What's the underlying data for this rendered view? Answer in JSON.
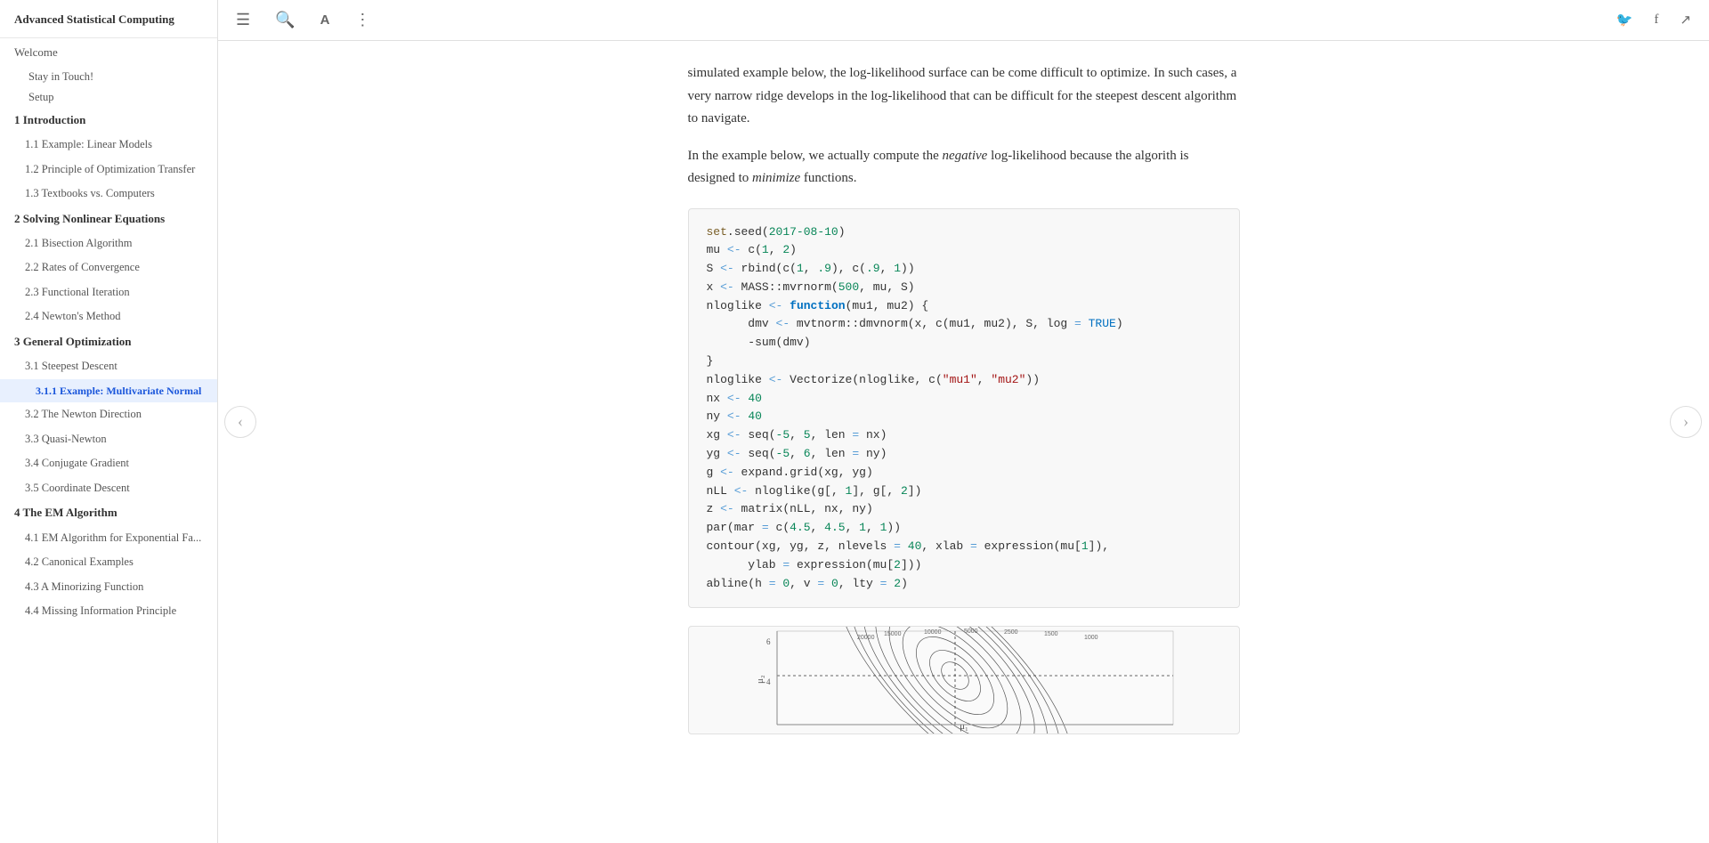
{
  "app": {
    "title": "Advanced Statistical Computing"
  },
  "topbar": {
    "icons": [
      "menu-icon",
      "search-icon",
      "font-icon",
      "more-icon"
    ],
    "social_icons": [
      "twitter-icon",
      "facebook-icon",
      "share-icon"
    ]
  },
  "sidebar": {
    "title": "Advanced Statistical Computing",
    "welcome_label": "Welcome",
    "items": [
      {
        "id": "stay-in-touch",
        "label": "Stay in Touch!",
        "level": "sub"
      },
      {
        "id": "setup",
        "label": "Setup",
        "level": "sub"
      },
      {
        "id": "ch1",
        "label": "1 Introduction",
        "level": "1"
      },
      {
        "id": "s1-1",
        "label": "1.1 Example: Linear Models",
        "level": "2"
      },
      {
        "id": "s1-2",
        "label": "1.2 Principle of Optimization Transfer",
        "level": "2"
      },
      {
        "id": "s1-3",
        "label": "1.3 Textbooks vs. Computers",
        "level": "2"
      },
      {
        "id": "ch2",
        "label": "2 Solving Nonlinear Equations",
        "level": "1"
      },
      {
        "id": "s2-1",
        "label": "2.1 Bisection Algorithm",
        "level": "2"
      },
      {
        "id": "s2-2",
        "label": "2.2 Rates of Convergence",
        "level": "2"
      },
      {
        "id": "s2-3",
        "label": "2.3 Functional Iteration",
        "level": "2"
      },
      {
        "id": "s2-4",
        "label": "2.4 Newton's Method",
        "level": "2"
      },
      {
        "id": "ch3",
        "label": "3 General Optimization",
        "level": "1"
      },
      {
        "id": "s3-1",
        "label": "3.1 Steepest Descent",
        "level": "2"
      },
      {
        "id": "s3-1-1",
        "label": "3.1.1 Example: Multivariate Normal",
        "level": "3",
        "active": true
      },
      {
        "id": "s3-2",
        "label": "3.2 The Newton Direction",
        "level": "2"
      },
      {
        "id": "s3-3",
        "label": "3.3 Quasi-Newton",
        "level": "2"
      },
      {
        "id": "s3-4",
        "label": "3.4 Conjugate Gradient",
        "level": "2"
      },
      {
        "id": "s3-5",
        "label": "3.5 Coordinate Descent",
        "level": "2"
      },
      {
        "id": "ch4",
        "label": "4 The EM Algorithm",
        "level": "1"
      },
      {
        "id": "s4-1",
        "label": "4.1 EM Algorithm for Exponential Fa...",
        "level": "2"
      },
      {
        "id": "s4-2",
        "label": "4.2 Canonical Examples",
        "level": "2"
      },
      {
        "id": "s4-3",
        "label": "4.3 A Minorizing Function",
        "level": "2"
      },
      {
        "id": "s4-4",
        "label": "4.4 Missing Information Principle",
        "level": "2"
      }
    ]
  },
  "content": {
    "para1": "simulated example below, the log-likelihood surface can be come difficult to optimize. In such cases, a very narrow ridge develops in the log-likelihood that can be difficult for the steepest descent algorithm to navigate.",
    "para2_prefix": "In the example below, we actually compute the ",
    "para2_italic": "negative",
    "para2_middle": " log-likelihood because the algorith is designed to ",
    "para2_italic2": "minimize",
    "para2_suffix": " functions.",
    "code": {
      "lines": [
        {
          "type": "normal",
          "text": "set.seed(2017-08-10)"
        },
        {
          "type": "normal",
          "text": "mu <- c(1, 2)"
        },
        {
          "type": "normal",
          "text": "S <- rbind(c(1, .9), c(.9, 1))"
        },
        {
          "type": "normal",
          "text": "x <- MASS::mvrnorm(500, mu, S)"
        },
        {
          "type": "normal",
          "text": "nloglike <- function(mu1, mu2) {"
        },
        {
          "type": "normal",
          "text": "    dmv <- mvtnorm::dmvnorm(x, c(mu1, mu2), S, log = TRUE)"
        },
        {
          "type": "normal",
          "text": "    -sum(dmv)"
        },
        {
          "type": "normal",
          "text": "}"
        },
        {
          "type": "normal",
          "text": "nloglike <- Vectorize(nloglike, c(\"mu1\", \"mu2\"))"
        },
        {
          "type": "normal",
          "text": "nx <- 40"
        },
        {
          "type": "normal",
          "text": "ny <- 40"
        },
        {
          "type": "normal",
          "text": "xg <- seq(-5, 5, len = nx)"
        },
        {
          "type": "normal",
          "text": "yg <- seq(-5, 6, len = ny)"
        },
        {
          "type": "normal",
          "text": "g <- expand.grid(xg, yg)"
        },
        {
          "type": "normal",
          "text": "nLL <- nloglike(g[, 1], g[, 2])"
        },
        {
          "type": "normal",
          "text": "z <- matrix(nLL, nx, ny)"
        },
        {
          "type": "normal",
          "text": "par(mar = c(4.5, 4.5, 1, 1))"
        },
        {
          "type": "normal",
          "text": "contour(xg, yg, z, nlevels = 40, xlab = expression(mu[1]),"
        },
        {
          "type": "normal",
          "text": "        ylab = expression(mu[2]))"
        },
        {
          "type": "normal",
          "text": "abline(h = 0, v = 0, lty = 2)"
        }
      ]
    }
  }
}
